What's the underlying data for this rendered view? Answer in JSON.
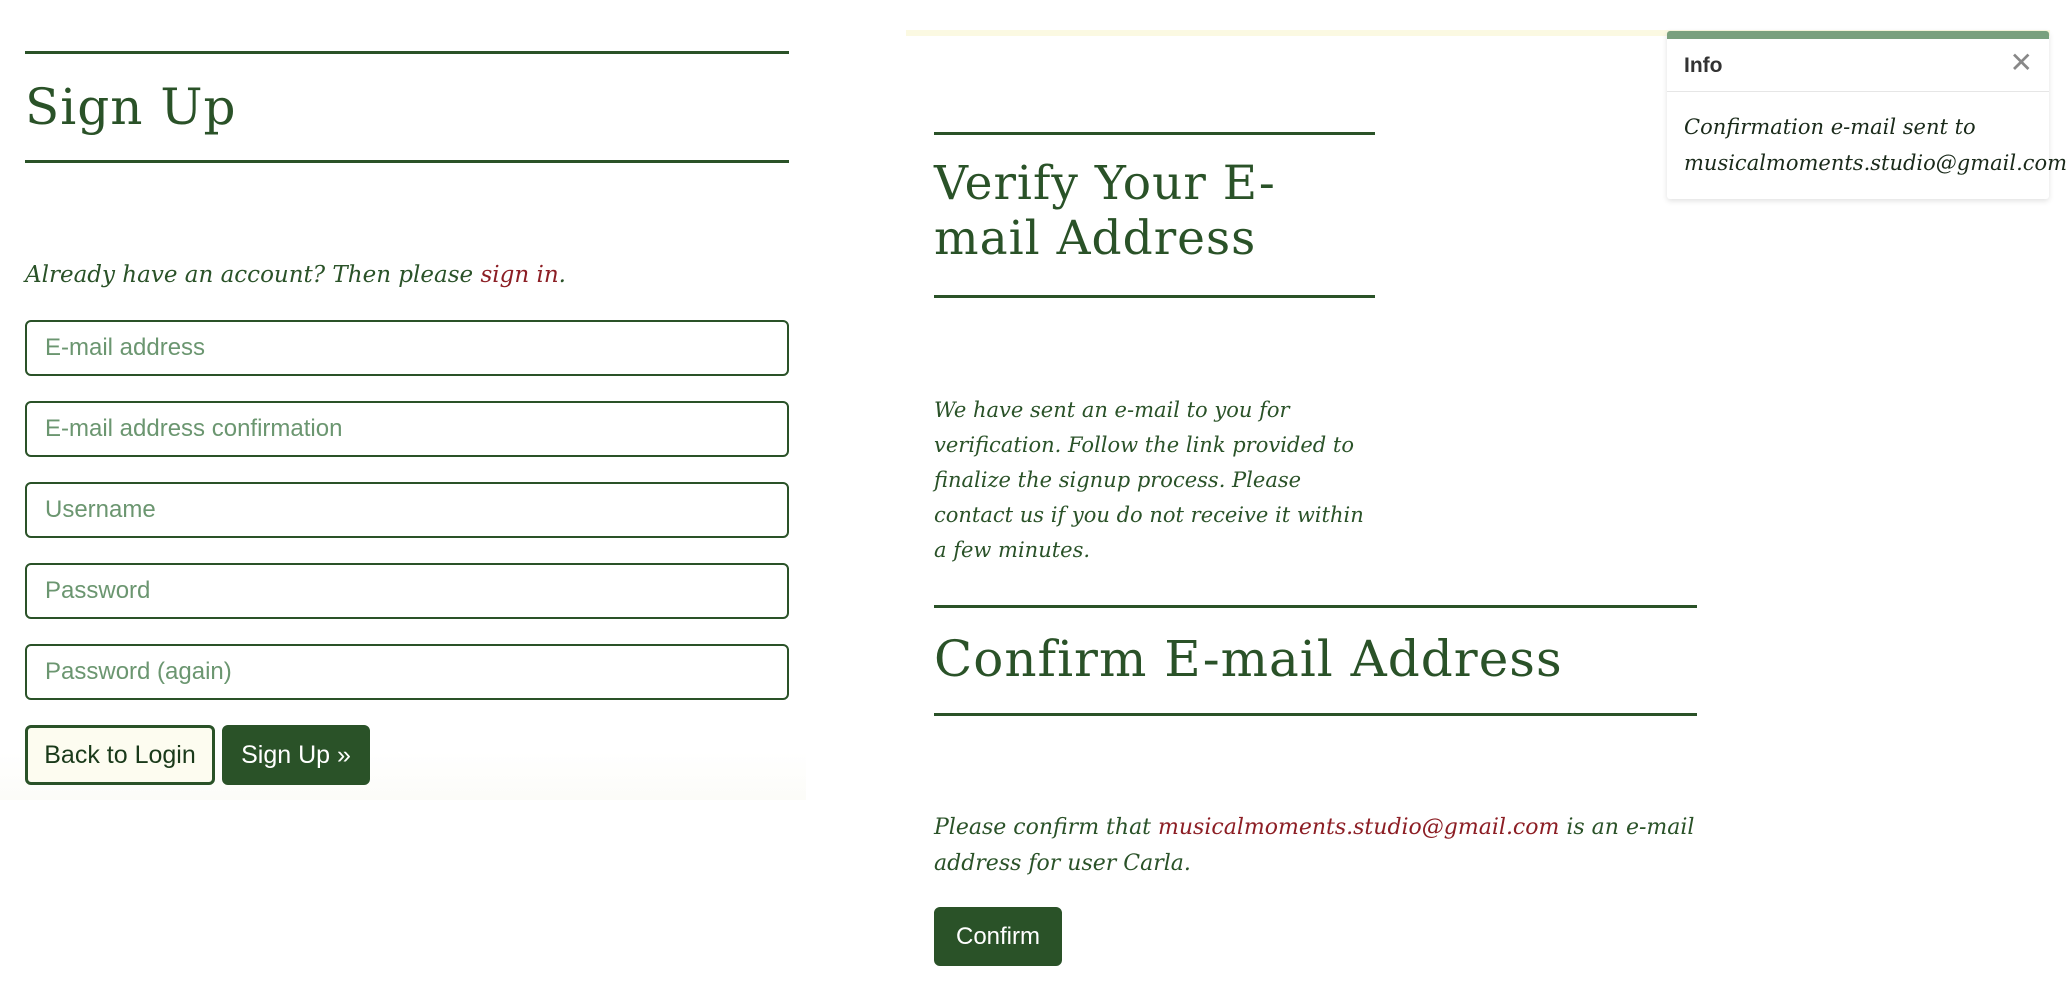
{
  "signup": {
    "title": "Sign Up",
    "intro_text": "Already have an account? Then please ",
    "intro_link": "sign in",
    "intro_end": ".",
    "fields": {
      "email_placeholder": "E-mail address",
      "email_confirm_placeholder": "E-mail address confirmation",
      "username_placeholder": "Username",
      "password_placeholder": "Password",
      "password_again_placeholder": "Password (again)"
    },
    "back_button": "Back to Login",
    "submit_button": "Sign Up »"
  },
  "verify": {
    "title": "Verify Your E-mail Address",
    "body": "We have sent an e-mail to you for verification. Follow the link provided to finalize the signup process. Please contact us if you do not receive it within a few minutes."
  },
  "confirm": {
    "title": "Confirm E-mail Address",
    "text_before": "Please confirm that ",
    "email_link": "musicalmoments.studio@gmail.com",
    "text_after": " is an e-mail address for user Carla.",
    "button": "Confirm"
  },
  "toast": {
    "title": "Info",
    "close_symbol": "✕",
    "message": "Confirmation e-mail sent to musicalmoments.studio@gmail.com."
  },
  "colors": {
    "primary_green": "#2a5228",
    "link_red": "#8c1e24",
    "toast_accent": "#7aa07e",
    "button_light_bg": "#fdfcf0"
  }
}
